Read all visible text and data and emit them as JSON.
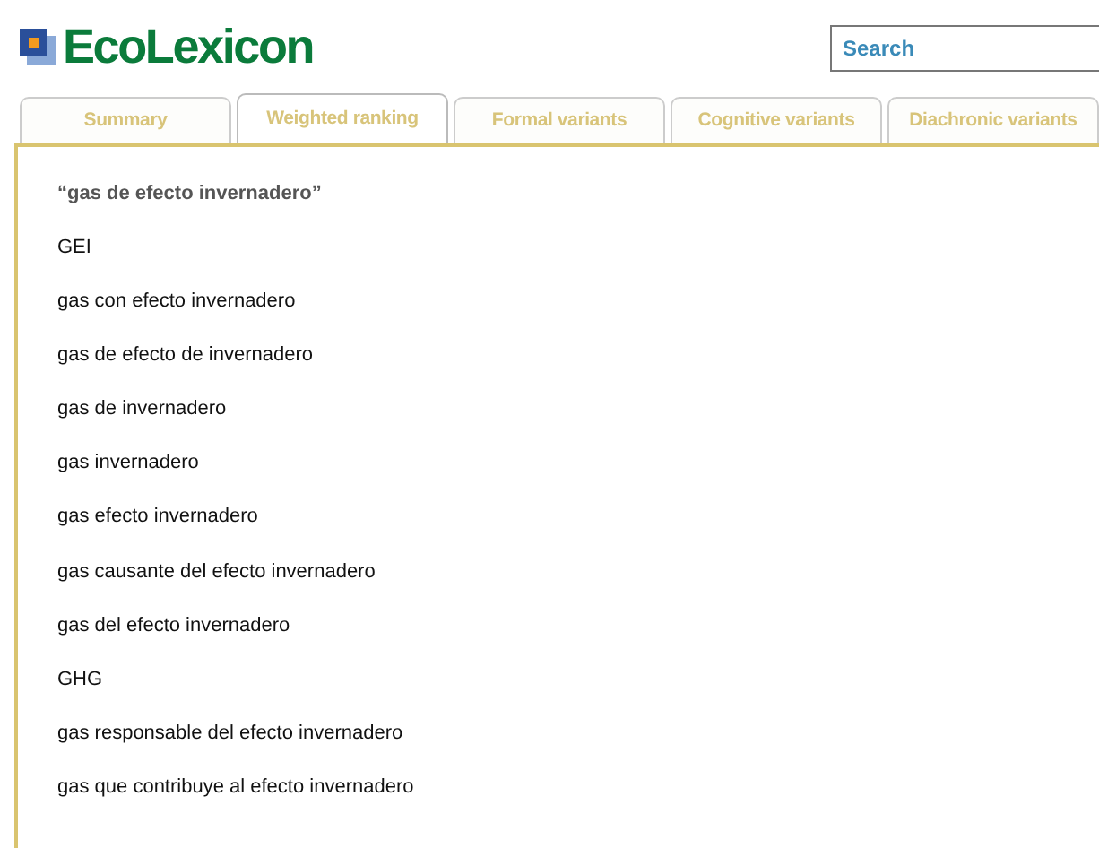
{
  "header": {
    "logo": "EcoLexicon",
    "search": {
      "placeholder": "Search"
    }
  },
  "tabs": [
    {
      "label": "Summary",
      "selected": false
    },
    {
      "label": "Weighted ranking",
      "selected": true
    },
    {
      "label": "Formal variants",
      "selected": false
    },
    {
      "label": "Cognitive variants",
      "selected": false
    },
    {
      "label": "Diachronic variants",
      "selected": false
    }
  ],
  "panel": {
    "heading": "“gas de efecto invernadero”",
    "terms": [
      "GEI",
      "gas con efecto invernadero",
      "gas de efecto de invernadero",
      "gas de invernadero",
      "gas invernadero",
      "gas efecto invernadero",
      "gas causante del efecto invernadero",
      "gas del efecto invernadero",
      "GHG",
      "gas responsable del efecto invernadero",
      "gas que contribuye al efecto invernadero"
    ]
  }
}
